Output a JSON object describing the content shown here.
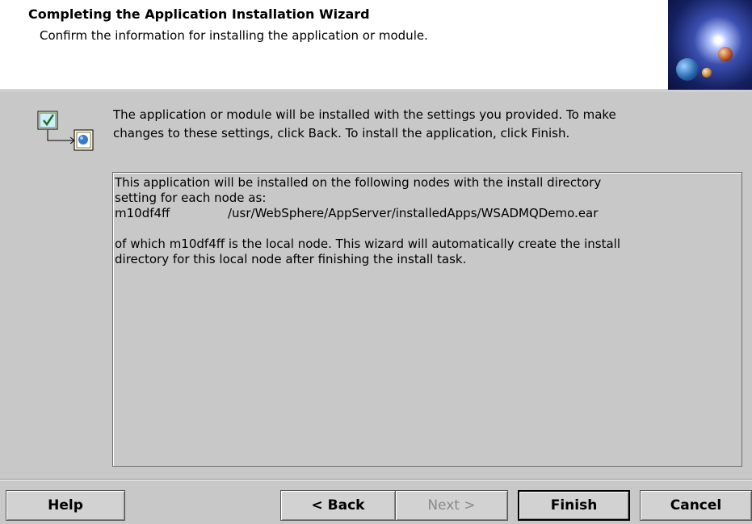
{
  "header": {
    "title": "Completing the Application Installation Wizard",
    "subtitle": "Confirm the information for installing the application or module."
  },
  "intro": {
    "line1": "The application or module will be installed with the settings you provided. To make",
    "line2": "changes to these settings, click Back. To install the application, click Finish."
  },
  "info": {
    "line1": "This application will be installed on the following nodes with the install directory",
    "line2": "setting for each node as:",
    "node_name": "m10df4ff",
    "node_path": "/usr/WebSphere/AppServer/installedApps/WSADMQDemo.ear",
    "line3": "of which m10df4ff is the local node. This wizard will automatically create the install",
    "line4": "directory for this local node after finishing the install task."
  },
  "buttons": {
    "help": "Help",
    "back": "< Back",
    "next": "Next >",
    "finish": "Finish",
    "cancel": "Cancel"
  }
}
